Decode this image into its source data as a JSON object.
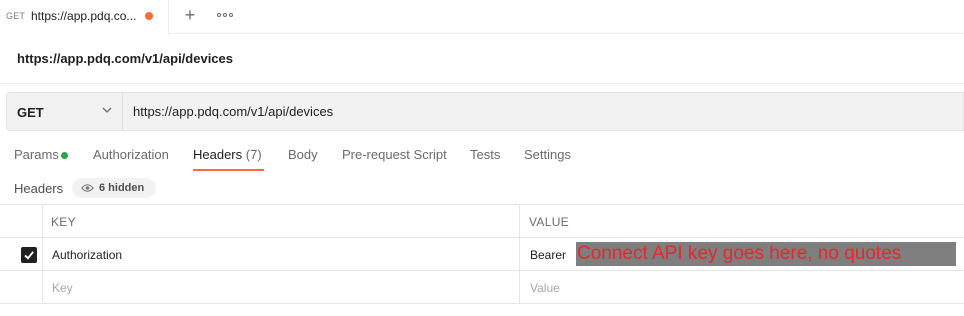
{
  "tabs": [
    {
      "method": "GET",
      "title": "https://app.pdq.co...",
      "unsaved_color": "#ff6c37"
    }
  ],
  "icons": {
    "new_tab": "plus-icon",
    "more": "ellipsis-icon",
    "method_dropdown": "chevron-down-icon",
    "hidden_headers": "eye-icon",
    "row_enabled": "checkmark-icon"
  },
  "request": {
    "title": "https://app.pdq.com/v1/api/devices",
    "method": "GET",
    "url": "https://app.pdq.com/v1/api/devices"
  },
  "request_tabs": {
    "params": "Params",
    "authorization": "Authorization",
    "headers": "Headers",
    "headers_count": "(7)",
    "body": "Body",
    "pre_request": "Pre-request Script",
    "tests": "Tests",
    "settings": "Settings",
    "active": "headers",
    "params_dot_color": "#28a745",
    "active_underline_color": "#ff6c37"
  },
  "headers_section": {
    "label": "Headers",
    "hidden_count": "6 hidden"
  },
  "table": {
    "columns": {
      "key": "KEY",
      "value": "VALUE"
    },
    "rows": [
      {
        "enabled": true,
        "key": "Authorization",
        "value": "Bearer",
        "annotation": "Connect API key goes here, no quotes"
      }
    ],
    "placeholder": {
      "key": "Key",
      "value": "Value"
    }
  },
  "colors": {
    "accent": "#ff6c37",
    "annotation_text": "#e8262c",
    "annotation_bg": "#7f7f7f"
  }
}
